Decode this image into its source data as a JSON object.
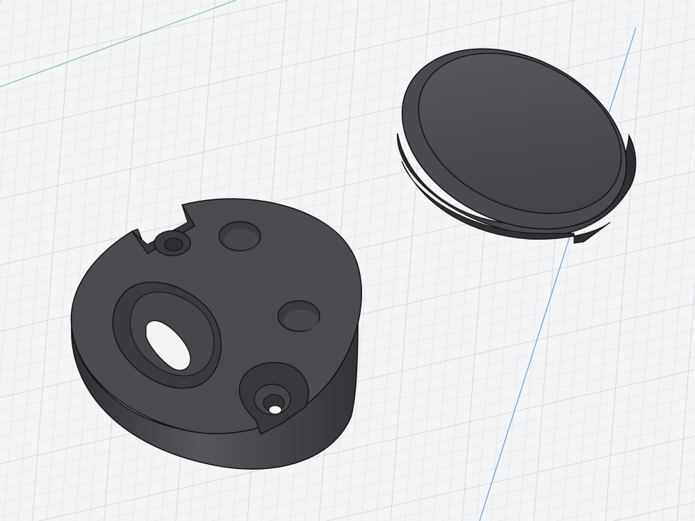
{
  "viewport": {
    "background": "#f4f5f6",
    "grid_minor_color": "#d9dcdf",
    "grid_major_color": "#c6cacd",
    "x_axis_color": "#7cc39a",
    "y_axis_color": "#5b9be6"
  },
  "parts": {
    "base_body_color": "#4b4b50",
    "base_side_color": "#3f3f44",
    "cap_top_color": "#4d4d52",
    "cap_rim_color": "#36363a",
    "edge_color": "#111111",
    "hole_interior_color": "#3a3a3f",
    "through_hole_color": "#f3f3f3"
  },
  "objects": [
    {
      "name": "base-plate",
      "interactable": true
    },
    {
      "name": "cap-disc",
      "interactable": true
    }
  ]
}
